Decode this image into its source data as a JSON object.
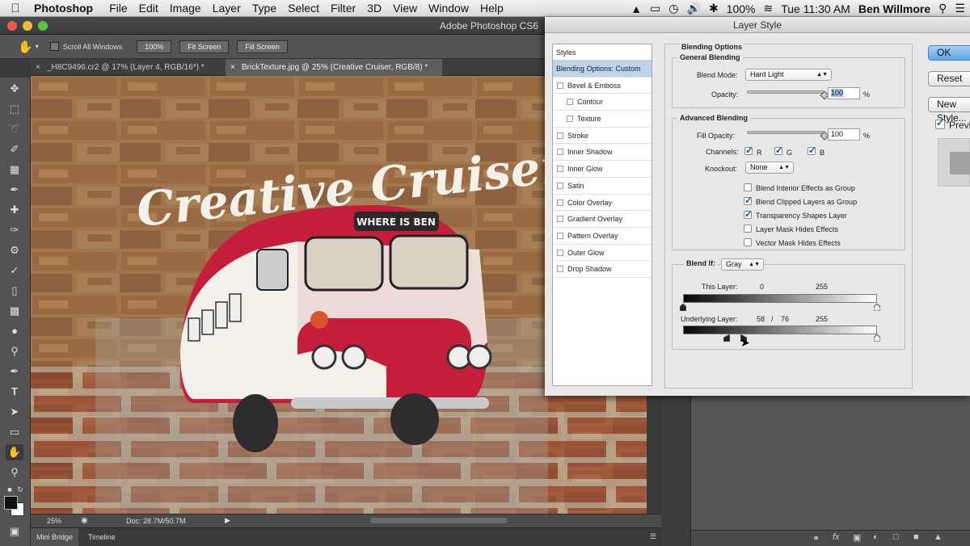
{
  "menubar": {
    "app_name": "Photoshop",
    "items": [
      "File",
      "Edit",
      "Image",
      "Layer",
      "Type",
      "Select",
      "Filter",
      "3D",
      "View",
      "Window",
      "Help"
    ],
    "battery": "100%",
    "clock": "Tue 11:30 AM",
    "user": "Ben Willmore"
  },
  "window": {
    "title": "Adobe Photoshop CS6"
  },
  "options_bar": {
    "scroll_all_windows": "Scroll All Windows",
    "zoom_btn": "100%",
    "fit_screen": "Fit Screen",
    "fill_screen": "Fill Screen"
  },
  "doc_tabs": [
    {
      "label": "_H8C9496.cr2 @ 17% (Layer 4, RGB/16*) *"
    },
    {
      "label": "BrickTexture.jpg @ 25% (Creative Cruiser, RGB/8) *"
    }
  ],
  "artwork": {
    "headline": "Creative Cruiser",
    "sign": "WHERE IS BEN"
  },
  "status": {
    "zoom": "25%",
    "doc": "Doc: 28.7M/50.7M"
  },
  "bottom_tabs": [
    "Mini Bridge",
    "Timeline"
  ],
  "layer_style": {
    "title": "Layer Style",
    "styles_header": "Styles",
    "styles": [
      {
        "label": "Blending Options: Custom",
        "checkbox": false,
        "sub": false,
        "selected": true
      },
      {
        "label": "Bevel & Emboss",
        "checkbox": true,
        "sub": false,
        "selected": false
      },
      {
        "label": "Contour",
        "checkbox": true,
        "sub": true,
        "selected": false
      },
      {
        "label": "Texture",
        "checkbox": true,
        "sub": true,
        "selected": false
      },
      {
        "label": "Stroke",
        "checkbox": true,
        "sub": false,
        "selected": false
      },
      {
        "label": "Inner Shadow",
        "checkbox": true,
        "sub": false,
        "selected": false
      },
      {
        "label": "Inner Glow",
        "checkbox": true,
        "sub": false,
        "selected": false
      },
      {
        "label": "Satin",
        "checkbox": true,
        "sub": false,
        "selected": false
      },
      {
        "label": "Color Overlay",
        "checkbox": true,
        "sub": false,
        "selected": false
      },
      {
        "label": "Gradient Overlay",
        "checkbox": true,
        "sub": false,
        "selected": false
      },
      {
        "label": "Pattern Overlay",
        "checkbox": true,
        "sub": false,
        "selected": false
      },
      {
        "label": "Outer Glow",
        "checkbox": true,
        "sub": false,
        "selected": false
      },
      {
        "label": "Drop Shadow",
        "checkbox": true,
        "sub": false,
        "selected": false
      }
    ],
    "blending_options": "Blending Options",
    "general_blending": "General Blending",
    "blend_mode_label": "Blend Mode:",
    "blend_mode": "Hard Light",
    "opacity_label": "Opacity:",
    "opacity": "100",
    "percent": "%",
    "advanced_blending": "Advanced Blending",
    "fill_opacity_label": "Fill Opacity:",
    "fill_opacity": "100",
    "channels_label": "Channels:",
    "channels": [
      {
        "label": "R",
        "checked": true
      },
      {
        "label": "G",
        "checked": true
      },
      {
        "label": "B",
        "checked": true
      }
    ],
    "knockout_label": "Knockout:",
    "knockout": "None",
    "options": [
      {
        "label": "Blend Interior Effects as Group",
        "checked": false
      },
      {
        "label": "Blend Clipped Layers as Group",
        "checked": true
      },
      {
        "label": "Transparency Shapes Layer",
        "checked": true
      },
      {
        "label": "Layer Mask Hides Effects",
        "checked": false
      },
      {
        "label": "Vector Mask Hides Effects",
        "checked": false
      }
    ],
    "blend_if_label": "Blend If:",
    "blend_if": "Gray",
    "this_layer_label": "This Layer:",
    "this_layer_low": "0",
    "this_layer_high": "255",
    "underlying_label": "Underlying Layer:",
    "underlying_low_a": "58",
    "underlying_sep": "/",
    "underlying_low_b": "76",
    "underlying_high": "255",
    "buttons": {
      "ok": "OK",
      "reset": "Reset",
      "new_style": "New Style...",
      "preview": "Preview",
      "preview_checked": true
    }
  }
}
